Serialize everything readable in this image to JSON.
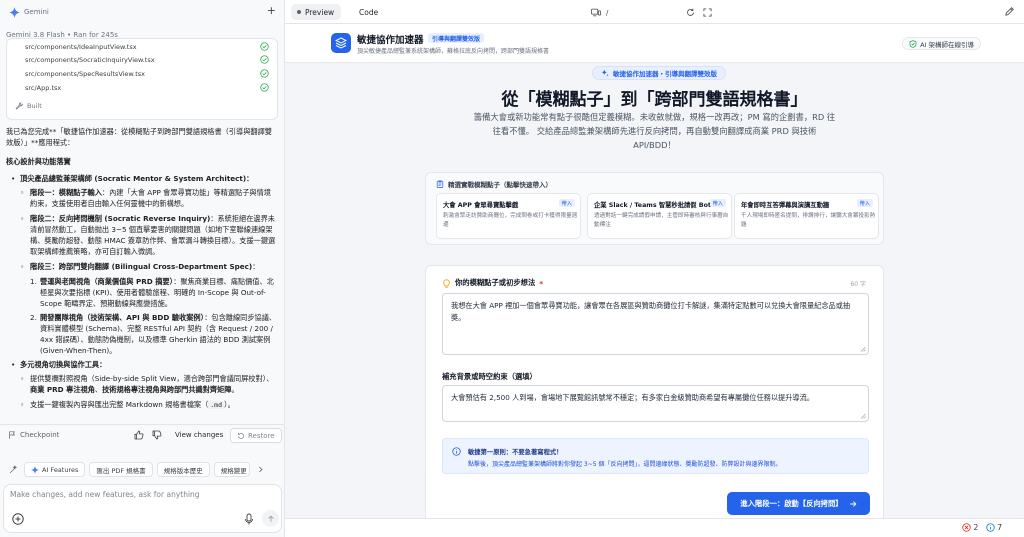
{
  "left_panel": {
    "header": {
      "title": "Gemini"
    },
    "run": {
      "model": "Gemini 3.8 Flash",
      "separator": "•",
      "duration": "Ran for 245s"
    },
    "files": [
      "src/components/IdeaInputView.tsx",
      "src/components/SocraticInquiryView.tsx",
      "src/components/SpecResultsView.tsx",
      "src/App.tsx"
    ],
    "built_label": "Built",
    "chat": {
      "intro": "我已為您完成**「敏捷協作加速器：從模糊點子到跨部門雙語規格書（引導與翻譯雙效版）」**應用程式：",
      "section_title": "核心設計與功能落實",
      "bullets": [
        {
          "title": "頂尖產品總監兼架構師 (Socratic Mentor & System Architect)：",
          "sub": [
            {
              "title": "階段一：模糊點子輸入",
              "text": "：內建「大會 APP 會眾尋寶功能」等精選點子與情境約束，支援使用者自由輸入任何靈機中的新構想。"
            },
            {
              "title": "階段二：反向拷問機制 (Socratic Reverse Inquiry)",
              "text": "：系統拒絕在邊界未清前冒然動工，自動抛出 3~5 個直擊要害的關鍵問題（如地下室聯線連線架構、獎勵防超發、動態 HMAC 簽章防作弊、會眾漏斗轉換目標）。支援一鍵選取架構師推薦策略，亦可自訂輸入微調。"
            },
            {
              "title": "階段三：跨部門雙向翻譯 (Bilingual Cross-Department Spec)",
              "text": "：",
              "items": [
                {
                  "n": "1.",
                  "title": "營運與老闆視角（商業價值與 PRD 摘要）",
                  "text": "：聚焦商業目標、痛點價值、北極星與次要指標 (KPI)、使用者體驗旅程、明確的 In-Scope 與 Out-of-Scope 範疇界定、預期動線與應變措施。"
                },
                {
                  "n": "2.",
                  "title": "開發團隊視角（技術架構、API 與 BDD 驗收案例）",
                  "text": "：包含離線同步協議、資料實體模型 (Schema)、完整 RESTful API 契約（含 Request / 200 / 4xx 錯誤碼）、動態防偽機制，以及標準 Gherkin 語法的 BDD 測試案例 (Given-When-Then)。"
                }
              ]
            }
          ]
        },
        {
          "title": "多元視角切換與協作工具：",
          "sub": [
            {
              "title": "",
              "text": "提供雙欄對照視角（Side-by-side Split View，適合跨部門會議同屏校對）、",
              "strong_a": "商業 PRD 專注視角",
              "mid": "、",
              "strong_b": "技術規格專注視角與跨部門共識對齊矩陣",
              "end": "。"
            },
            {
              "title": "",
              "text": "支援一鍵複製內容與匯出完整 Markdown 規格書檔案（",
              "code": ".md",
              "end": "）。"
            }
          ]
        }
      ]
    },
    "checkpoint": {
      "label": "Checkpoint",
      "view_changes": "View changes",
      "restore": "Restore"
    },
    "suggestions": [
      "AI Features",
      "匯出 PDF 規格書",
      "規格版本歷史",
      "規格變更"
    ],
    "composer": {
      "placeholder": "Make changes, add new features, ask for anything",
      "value": ""
    }
  },
  "topbar": {
    "tabs": [
      "Preview",
      "Code"
    ],
    "url_path": "/"
  },
  "app": {
    "header": {
      "title": "敏捷協作加速器",
      "badge": "引導與翻譯雙效版",
      "subtitle": "頂尖敏捷產品總監兼系統架構師，蘇格拉底反向拷問，跨部門雙語規格書",
      "status": "AI 架構師在線引導"
    },
    "hero": {
      "tag": "敏捷協作加速器・引導與翻譯雙效版",
      "title": "從「模糊點子」到「跨部門雙語規格書」",
      "description": "籌備大會或新功能常有點子很酷但定義模糊。未收斂就做，規格一改再改；PM 寫的企劃書，RD 往往看不懂。 交給產品總監兼架構師先進行反向拷問，再自動雙向翻譯成商業 PRD 與技術 API/BDD！"
    },
    "demo": {
      "title": "精選實戰模糊點子（點擊快速帶入）",
      "items": [
        {
          "title": "大會 APP 會眾尋寶點擊戲",
          "tag": "帶入",
          "desc": "刺激會眾走訪贊助商攤位，完成問卷或打卡獲得限量週邊"
        },
        {
          "title": "企業 Slack / Teams 智慧秒批請假 Bot",
          "tag": "帶入",
          "desc": "透過對話一鍵完成請假申請，主管即時審核與行事曆自動標注"
        },
        {
          "title": "年會即時互答彈幕與演講互動牆",
          "tag": "帶入",
          "desc": "千人現場即時匿名提問，排讚排行，讓聽大會冪投影熱題"
        }
      ]
    },
    "form": {
      "q1": {
        "label": "你的模糊點子或初步想法",
        "required": "*",
        "count": "60 字",
        "value": "我想在大會 APP 裡加一個會眾尋寶功能，讓會眾在各展區與贊助商攤位打卡解謎，集滿特定點數可以兌換大會限量紀念品或抽獎。"
      },
      "q2": {
        "label": "補充背景或時空約束（選填）",
        "value": "大會預估有 2,500 人到場，會場地下展覽館訊號常不穩定；有多家白金級贊助商希望有專屬攤位任務以提升導流。"
      },
      "tip": {
        "title": "敏捷第一原則：不要急著寫程式！",
        "body": "點擊後，頂尖產品總監兼架構師將對你發起 3~5 個「反向拷問」，逼問邊緣狀態、獎勵防超發、防弊設計與邊界限制。"
      },
      "submit": "進入階段一：啟動【反向拷問】"
    }
  },
  "bottombar": {
    "errors": "2",
    "warnings": "7"
  },
  "colors": {
    "accent": "#2563eb",
    "success": "#34a853",
    "error": "#d93025"
  }
}
